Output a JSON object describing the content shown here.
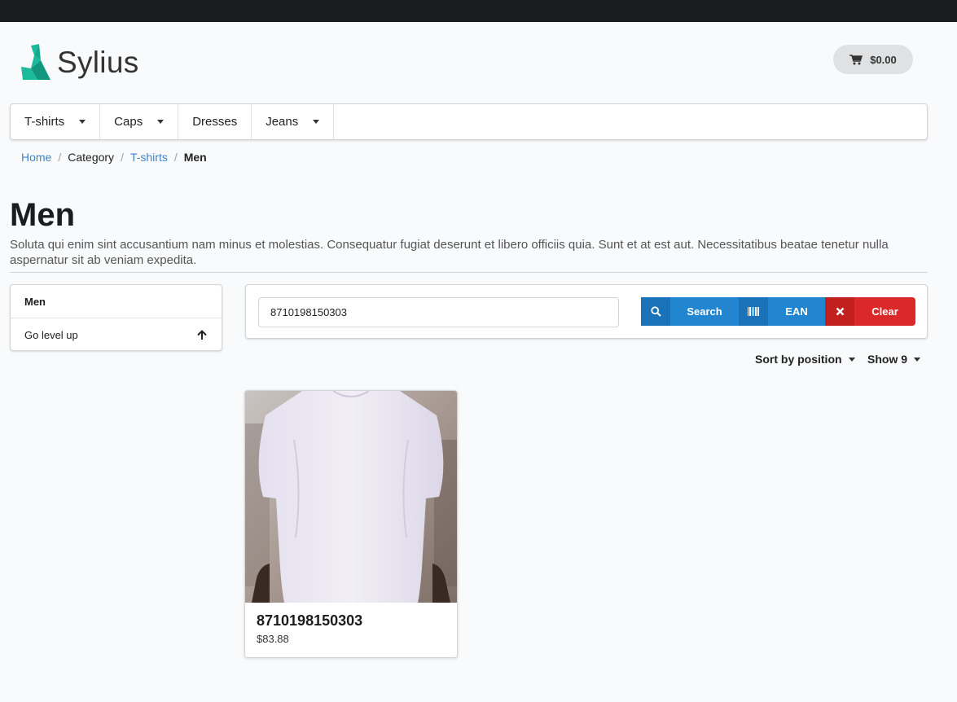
{
  "brand": {
    "name": "Sylius"
  },
  "cart": {
    "total": "$0.00",
    "icon": "cart-icon"
  },
  "menu": {
    "items": [
      {
        "label": "T-shirts",
        "has_dropdown": true
      },
      {
        "label": "Caps",
        "has_dropdown": true
      },
      {
        "label": "Dresses",
        "has_dropdown": false
      },
      {
        "label": "Jeans",
        "has_dropdown": true
      }
    ]
  },
  "breadcrumb": {
    "items": [
      {
        "label": "Home",
        "link": true
      },
      {
        "label": "Category",
        "link": false
      },
      {
        "label": "T-shirts",
        "link": true
      },
      {
        "label": "Men",
        "active": true
      }
    ]
  },
  "page": {
    "title": "Men",
    "description": "Soluta qui enim sint accusantium nam minus et molestias. Consequatur fugiat deserunt et libero officiis quia. Sunt et at est aut. Necessitatibus beatae tenetur nulla aspernatur sit ab veniam expedita."
  },
  "sidebar": {
    "header": "Men",
    "go_up": "Go level up",
    "go_up_icon": "arrow-up-icon"
  },
  "search": {
    "value": "8710198150303",
    "search_label": "Search",
    "ean_label": "EAN",
    "clear_label": "Clear",
    "icons": [
      "search-icon",
      "barcode-icon",
      "close-icon"
    ]
  },
  "sorting": {
    "sort_label": "Sort by position",
    "show_label": "Show 9"
  },
  "products": [
    {
      "name": "8710198150303",
      "price": "$83.88"
    }
  ],
  "colors": {
    "primary": "#2185d0",
    "danger": "#db2828",
    "brand": "#1abb9c",
    "link": "#4183c4"
  }
}
